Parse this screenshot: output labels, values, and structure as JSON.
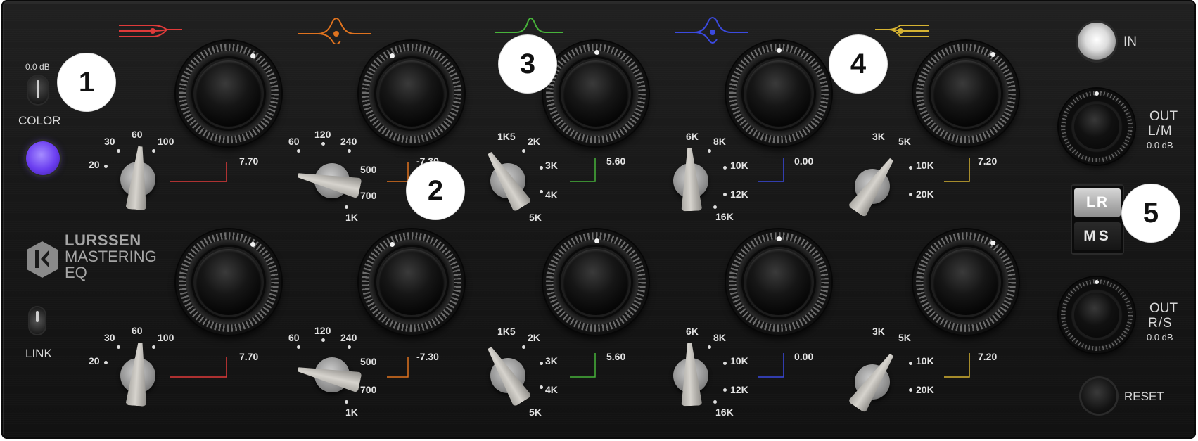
{
  "plugin": {
    "brand_line1": "LURSSEN",
    "brand_line2": "MASTERING",
    "brand_line3": "EQ"
  },
  "left_controls": {
    "color_db": "0.0 dB",
    "color_label": "COLOR",
    "link_label": "LINK"
  },
  "right_controls": {
    "in_label": "IN",
    "out_lm_label": "OUT",
    "out_lm_sub": "L/M",
    "out_lm_db": "0.0 dB",
    "lr_label": "LR",
    "ms_label": "MS",
    "out_rs_label": "OUT",
    "out_rs_sub": "R/S",
    "out_rs_db": "0.0 dB",
    "reset_label": "RESET"
  },
  "band_colors": [
    "#e03a3a",
    "#e0731f",
    "#47b33a",
    "#3b4ae0",
    "#d6b332"
  ],
  "bands_top": {
    "b1": {
      "ticks": [
        "20",
        "30",
        "60",
        "100"
      ],
      "value": "7.70"
    },
    "b2": {
      "ticks": [
        "60",
        "120",
        "240",
        "500",
        "700",
        "1K"
      ],
      "value": "-7.30"
    },
    "b3": {
      "ticks": [
        "1K5",
        "2K",
        "3K",
        "4K",
        "5K"
      ],
      "value": "5.60"
    },
    "b4": {
      "ticks": [
        "6K",
        "8K",
        "10K",
        "12K",
        "16K"
      ],
      "value": "0.00"
    },
    "b5": {
      "ticks": [
        "3K",
        "5K",
        "10K",
        "20K"
      ],
      "value": "7.20"
    }
  },
  "bands_bottom": {
    "b1": {
      "ticks": [
        "20",
        "30",
        "60",
        "100"
      ],
      "value": "7.70"
    },
    "b2": {
      "ticks": [
        "60",
        "120",
        "240",
        "500",
        "700",
        "1K"
      ],
      "value": "-7.30"
    },
    "b3": {
      "ticks": [
        "1K5",
        "2K",
        "3K",
        "4K",
        "5K"
      ],
      "value": "5.60"
    },
    "b4": {
      "ticks": [
        "6K",
        "8K",
        "10K",
        "12K",
        "16K"
      ],
      "value": "0.00"
    },
    "b5": {
      "ticks": [
        "3K",
        "5K",
        "10K",
        "20K"
      ],
      "value": "7.20"
    }
  },
  "callouts": [
    "1",
    "2",
    "3",
    "4",
    "5"
  ]
}
